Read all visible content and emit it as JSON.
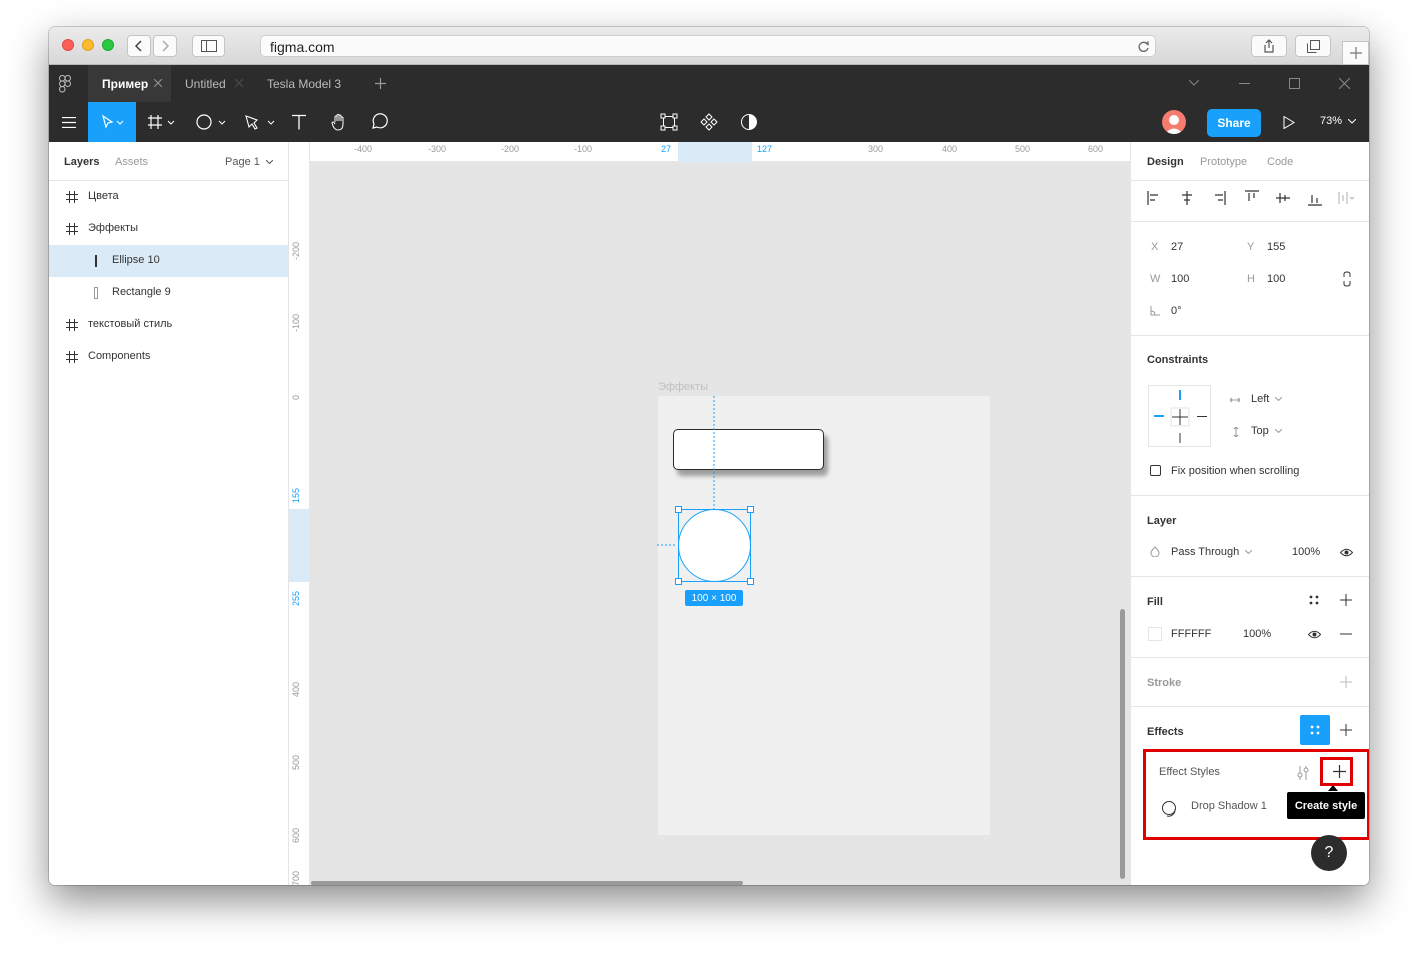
{
  "browser": {
    "url": "figma.com"
  },
  "tabs": [
    {
      "label": "Пример",
      "active": true
    },
    {
      "label": "Untitled",
      "active": false
    },
    {
      "label": "Tesla Model 3",
      "active": false
    }
  ],
  "toolbar": {
    "share_label": "Share",
    "zoom": "73%",
    "accent": "#18a0fb"
  },
  "left_panel": {
    "tabs": [
      "Layers",
      "Assets"
    ],
    "page": "Page 1",
    "layers": [
      {
        "name": "Цвета",
        "type": "frame"
      },
      {
        "name": "Эффекты",
        "type": "frame"
      },
      {
        "name": "Ellipse 10",
        "type": "ellipse",
        "selected": true
      },
      {
        "name": "Rectangle 9",
        "type": "rectangle"
      },
      {
        "name": "текстовый стиль",
        "type": "frame"
      },
      {
        "name": "Components",
        "type": "frame"
      }
    ]
  },
  "canvas": {
    "frame_label": "Эффекты",
    "selection_size": "100 × 100",
    "ruler_top": [
      "-400",
      "-300",
      "-200",
      "-100",
      "27",
      "127",
      "300",
      "400",
      "500",
      "600"
    ],
    "ruler_left": [
      "-200",
      "-100",
      "0",
      "155",
      "255",
      "400",
      "500",
      "600",
      "700"
    ]
  },
  "right_panel": {
    "tabs": [
      "Design",
      "Prototype",
      "Code"
    ],
    "x": "27",
    "y": "155",
    "w": "100",
    "h": "100",
    "rotation": "0°",
    "constraints_title": "Constraints",
    "constraint_h": "Left",
    "constraint_v": "Top",
    "fix_position": "Fix position when scrolling",
    "layer_title": "Layer",
    "blend_mode": "Pass Through",
    "layer_opacity": "100%",
    "fill_title": "Fill",
    "fill_hex": "FFFFFF",
    "fill_opacity": "100%",
    "stroke_title": "Stroke",
    "effects_title": "Effects",
    "effect_styles_title": "Effect Styles",
    "effect_style_item": "Drop Shadow 1",
    "tooltip": "Create style",
    "help": "?"
  },
  "highlight_color": "#e00000"
}
